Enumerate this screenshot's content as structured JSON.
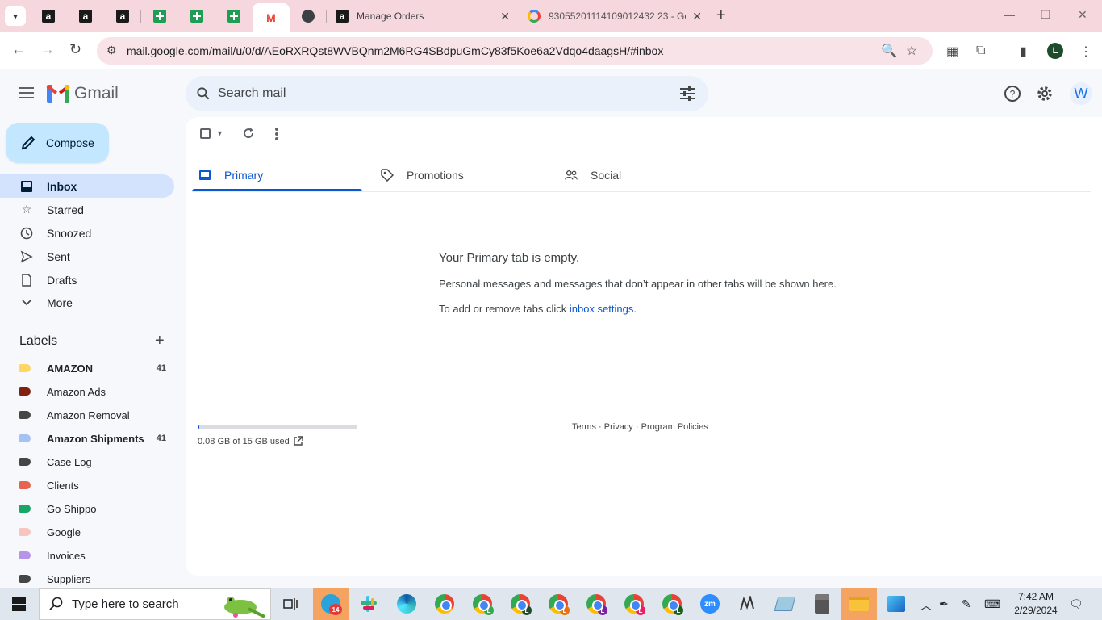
{
  "browser": {
    "tabs": [
      {
        "title": "Manage Orders",
        "icon": "amazon-icon"
      },
      {
        "title": "93055201114109012432 23 - Go",
        "icon": "google-icon"
      }
    ],
    "new_tab": "+",
    "url": "mail.google.com/mail/u/0/d/AEoRXRQst8WVBQnm2M6RG4SBdpuGmCy83f5Koe6a2Vdqo4daagsH/#inbox",
    "profile_initial": "L",
    "window": {
      "minimize": "—",
      "restore": "❐",
      "close": "✕"
    }
  },
  "gmail": {
    "logo_text": "Gmail",
    "search_placeholder": "Search mail",
    "avatar_initial": "W",
    "compose_label": "Compose",
    "nav": [
      {
        "label": "Inbox",
        "icon": "inbox-icon"
      },
      {
        "label": "Starred",
        "icon": "star-icon"
      },
      {
        "label": "Snoozed",
        "icon": "clock-icon"
      },
      {
        "label": "Sent",
        "icon": "send-icon"
      },
      {
        "label": "Drafts",
        "icon": "draft-icon"
      },
      {
        "label": "More",
        "icon": "chevron-down-icon"
      }
    ],
    "labels_title": "Labels",
    "labels": [
      {
        "name": "AMAZON",
        "count": "41",
        "color": "#fdd663"
      },
      {
        "name": "Amazon Ads",
        "count": "",
        "color": "#822111"
      },
      {
        "name": "Amazon Removal",
        "count": "",
        "color": "#444746"
      },
      {
        "name": "Amazon Shipments",
        "count": "41",
        "color": "#a4c2f4"
      },
      {
        "name": "Case Log",
        "count": "",
        "color": "#444746"
      },
      {
        "name": "Clients",
        "count": "",
        "color": "#e66550"
      },
      {
        "name": "Go Shippo",
        "count": "",
        "color": "#16a766"
      },
      {
        "name": "Google",
        "count": "",
        "color": "#f6c5be"
      },
      {
        "name": "Invoices",
        "count": "",
        "color": "#b694e8"
      },
      {
        "name": "Suppliers",
        "count": "",
        "color": "#444746"
      }
    ],
    "category_tabs": [
      {
        "label": "Primary",
        "icon": "inbox-tab-icon"
      },
      {
        "label": "Promotions",
        "icon": "tag-icon"
      },
      {
        "label": "Social",
        "icon": "people-icon"
      }
    ],
    "empty": {
      "title": "Your Primary tab is empty.",
      "description": "Personal messages and messages that don’t appear in other tabs will be shown here.",
      "settings_prefix": "To add or remove tabs click ",
      "settings_link": "inbox settings",
      "settings_suffix": "."
    },
    "storage": {
      "text": "0.08 GB of 15 GB used",
      "fraction": 0.005
    },
    "footer": {
      "terms": "Terms",
      "privacy": "Privacy",
      "policies": "Program Policies",
      "sep": "·"
    }
  },
  "taskbar": {
    "search_placeholder": "Type here to search",
    "badge_count": "14",
    "time": "7:42 AM",
    "date": "2/29/2024"
  },
  "colors": {
    "accent": "#0b57d0",
    "compose": "#c2e7ff",
    "inbox_active": "#d3e3fd",
    "tabstrip": "#f6d7de"
  }
}
